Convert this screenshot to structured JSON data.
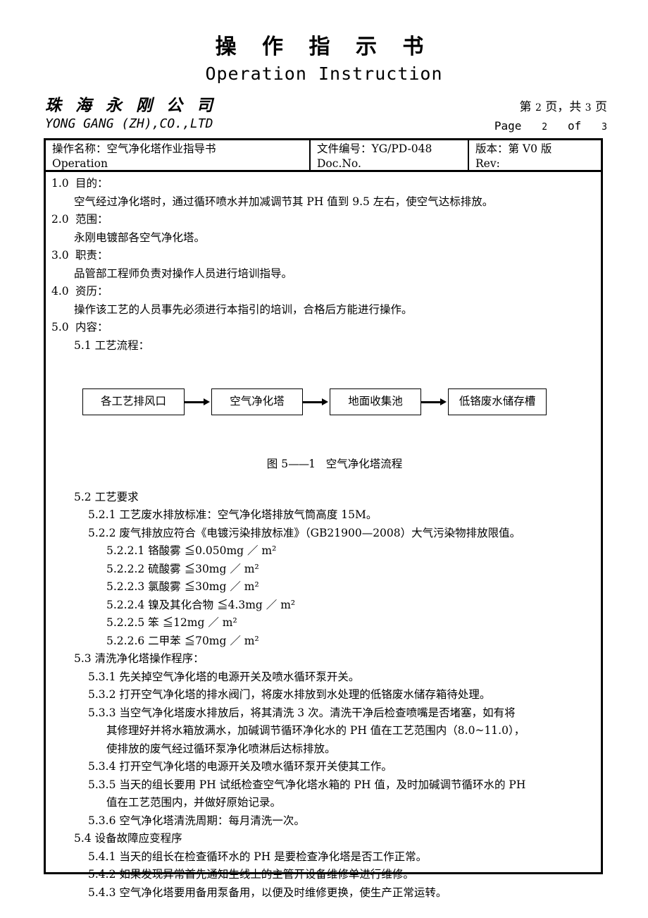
{
  "header": {
    "title_cn": "操 作 指 示 书",
    "title_en": "Operation  Instruction",
    "company_cn": "珠 海 永 刚 公 司",
    "company_en": "YONG GANG (ZH),CO.,LTD",
    "page_cn_prefix": "第",
    "page_cn_current": "2",
    "page_cn_mid": "页，共",
    "page_cn_total": "3",
    "page_cn_suffix": "页",
    "page_en_prefix": "Page",
    "page_en_current": "2",
    "page_en_mid": "of",
    "page_en_total": "3"
  },
  "info_table": {
    "operation_label_cn": "操作名称：空气净化塔作业指导书",
    "operation_label_en": "Operation",
    "docno_label_cn": "文件编号：YG/PD-048",
    "docno_label_en": "Doc.No.",
    "rev_label_cn": "版本：第 V0 版",
    "rev_label_en": "Rev:"
  },
  "sections": {
    "s1_num": "1.0",
    "s1_title": "目的：",
    "s1_body": "空气经过净化塔时，通过循环喷水并加减调节其 PH 值到 9.5 左右，使空气达标排放。",
    "s2_num": "2.0",
    "s2_title": "范围：",
    "s2_body": "永刚电镀部各空气净化塔。",
    "s3_num": "3.0",
    "s3_title": "职责：",
    "s3_body": "品管部工程师负责对操作人员进行培训指导。",
    "s4_num": "4.0",
    "s4_title": "资历：",
    "s4_body": "操作该工艺的人员事先必须进行本指引的培训，合格后方能进行操作。",
    "s5_num": "5.0",
    "s5_title": "内容：",
    "s51": "5.1  工艺流程：",
    "s52": "5.2  工艺要求",
    "s521": "5.2.1 工艺废水排放标准：空气净化塔排放气筒高度 15M。",
    "s522": "5.2.2 废气排放应符合《电镀污染排放标准》（GB21900—2008）大气污染物排放限值。",
    "s5221": "5.2.2.1 铬酸雾 ≦0.050mg ／ m²",
    "s5222": "5.2.2.2 硫酸雾 ≦30mg ／ m²",
    "s5223": "5.2.2.3 氯酸雾 ≦30mg ／ m²",
    "s5224": "5.2.2.4 镍及其化合物 ≦4.3mg ／ m²",
    "s5225": "5.2.2.5 笨 ≦12mg ／ m²",
    "s5226": "5.2.2.6 二甲苯 ≦70mg ／ m²",
    "s53": "5.3  清洗净化塔操作程序：",
    "s531": "5.3.1 先关掉空气净化塔的电源开关及喷水循环泵开关。",
    "s532": "5.3.2 打开空气净化塔的排水阀门，将废水排放到水处理的低铬废水储存箱待处理。",
    "s533_l1": "5.3.3 当空气净化塔废水排放后，将其清洗 3 次。清洗干净后检查喷嘴是否堵塞，如有将",
    "s533_l2": "其修理好并将水箱放满水，加碱调节循环净化水的 PH  值在工艺范围内（8.0~11.0），",
    "s533_l3": "使排放的废气经过循环泵净化喷淋后达标排放。",
    "s534": "5.3.4 打开空气净化塔的电源开关及喷水循环泵开关使其工作。",
    "s535_l1": "5.3.5 当天的组长要用 PH 试纸检查空气净化塔水箱的 PH 值，及时加碱调节循环水的 PH",
    "s535_l2": "值在工艺范围内，并做好原始记录。",
    "s536": "5.3.6 空气净化塔清洗周期：每月清洗一次。",
    "s54": "5.4  设备故障应变程序",
    "s541": "5.4.1 当天的组长在检查循环水的 PH 是要检查净化塔是否工作正常。",
    "s542": "5.4.2 如果发现异常首先通知生线上的主管开设备维修单进行维修。",
    "s543": "5.4.3 空气净化塔要用备用泵备用，以便及时维修更换，使生产正常运转。"
  },
  "flow_diagram": {
    "box1": "各工艺排风口",
    "box2": "空气净化塔",
    "box3": "地面收集池",
    "box4": "低铬废水储存槽",
    "caption_prefix": "图 5",
    "caption_dash": "——",
    "caption_num": "1",
    "caption_text": "空气净化塔流程"
  }
}
